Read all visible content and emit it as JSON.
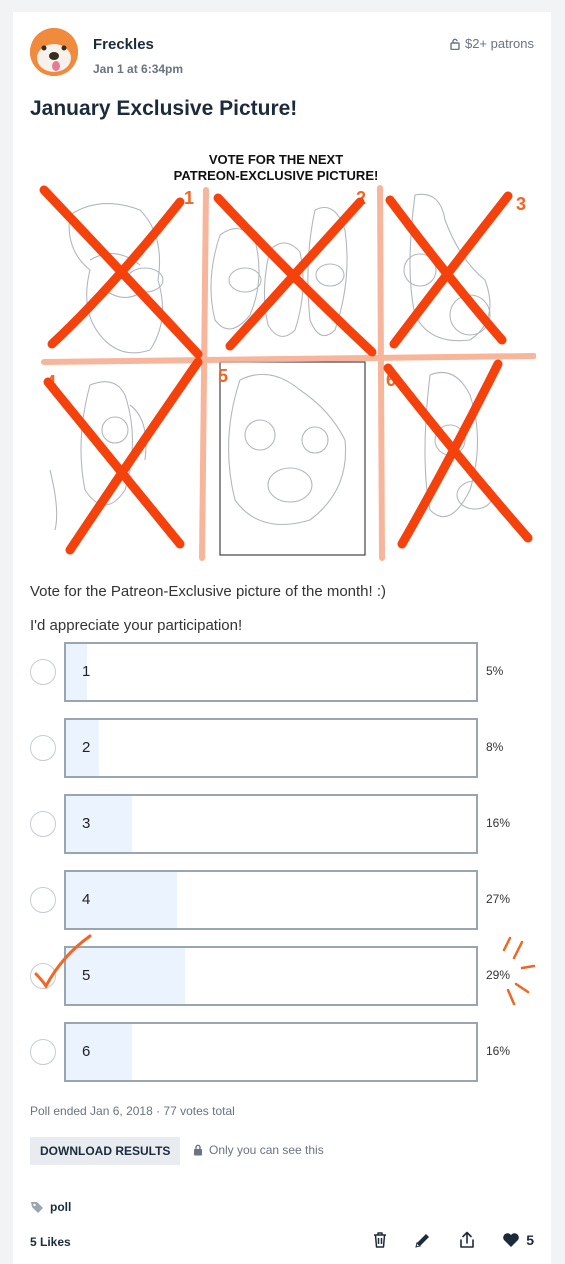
{
  "post": {
    "author": "Freckles",
    "date": "Jan 1 at 6:34pm",
    "tier": "$2+ patrons",
    "title": "January Exclusive Picture!",
    "image_caption_line1": "VOTE FOR THE NEXT",
    "image_caption_line2": "PATREON-EXCLUSIVE PICTURE!",
    "image_numbers": [
      "1",
      "2",
      "3",
      "4",
      "5",
      "6"
    ],
    "description1": "Vote for the Patreon-Exclusive picture of the month! :)",
    "description2": "I'd appreciate your participation!"
  },
  "poll": {
    "options": [
      {
        "label": "1",
        "percent_text": "5%",
        "percent": 5,
        "selected": false
      },
      {
        "label": "2",
        "percent_text": "8%",
        "percent": 8,
        "selected": false
      },
      {
        "label": "3",
        "percent_text": "16%",
        "percent": 16,
        "selected": false
      },
      {
        "label": "4",
        "percent_text": "27%",
        "percent": 27,
        "selected": false
      },
      {
        "label": "5",
        "percent_text": "29%",
        "percent": 29,
        "selected": true
      },
      {
        "label": "6",
        "percent_text": "16%",
        "percent": 16,
        "selected": false
      }
    ],
    "meta": "Poll ended Jan 6, 2018 · 77 votes total",
    "download_label": "DOWNLOAD RESULTS",
    "private_note": "Only you can see this"
  },
  "footer": {
    "tag": "poll",
    "likes_text": "5 Likes",
    "like_count": "5"
  },
  "colors": {
    "accent": "#f26522",
    "bar_fill": "#eaf3fe",
    "bar_border": "#9aa5b0",
    "text_dark": "#1c2b3c"
  },
  "icons": {
    "tier": "lock-icon",
    "private": "lock-icon",
    "tag": "tag-icon",
    "delete": "trash-icon",
    "edit": "pencil-icon",
    "share": "share-icon",
    "like": "heart-icon"
  }
}
